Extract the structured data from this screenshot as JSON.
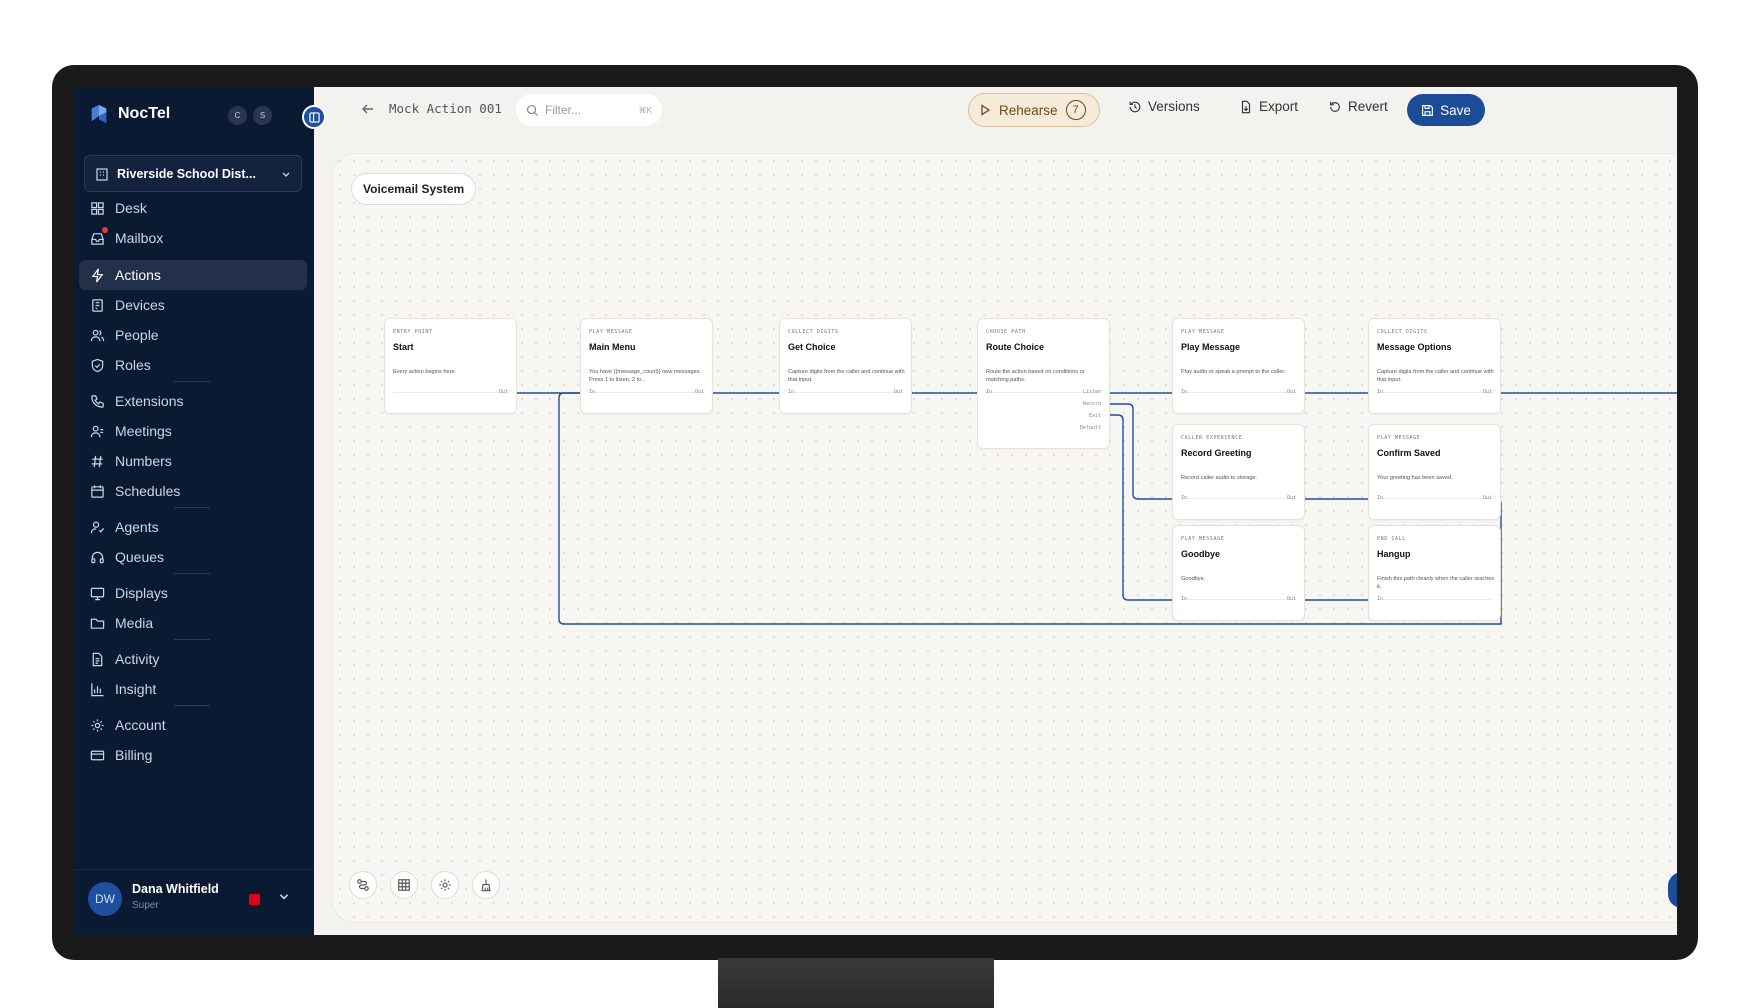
{
  "brand": {
    "name": "NocTel",
    "badges": [
      "C",
      "S"
    ]
  },
  "org": {
    "name": "Riverside School Dist..."
  },
  "nav": [
    {
      "label": "Desk",
      "icon": "grid-icon"
    },
    {
      "label": "Mailbox",
      "icon": "inbox-icon",
      "notification": true
    },
    {
      "label": "Actions",
      "icon": "lightning-icon",
      "active": true
    },
    {
      "label": "Devices",
      "icon": "device-icon"
    },
    {
      "label": "People",
      "icon": "people-icon"
    },
    {
      "label": "Roles",
      "icon": "shield-icon"
    },
    {
      "label": "Extensions",
      "icon": "phone-icon"
    },
    {
      "label": "Meetings",
      "icon": "meetings-icon"
    },
    {
      "label": "Numbers",
      "icon": "hash-icon"
    },
    {
      "label": "Schedules",
      "icon": "calendar-icon"
    },
    {
      "label": "Agents",
      "icon": "agent-icon"
    },
    {
      "label": "Queues",
      "icon": "headset-icon"
    },
    {
      "label": "Displays",
      "icon": "monitor-icon"
    },
    {
      "label": "Media",
      "icon": "folder-icon"
    },
    {
      "label": "Activity",
      "icon": "document-icon"
    },
    {
      "label": "Insight",
      "icon": "bar-chart-icon"
    },
    {
      "label": "Account",
      "icon": "gear-icon"
    },
    {
      "label": "Billing",
      "icon": "credit-card-icon"
    }
  ],
  "user": {
    "initials": "DW",
    "name": "Dana Whitfield",
    "role": "Super",
    "status_color": "#e0001b"
  },
  "topbar": {
    "title": "Mock Action 001",
    "filter_placeholder": "Filter...",
    "filter_shortcut": "⌘K",
    "rehearse_label": "Rehearse",
    "rehearse_count": "7",
    "versions_label": "Versions",
    "export_label": "Export",
    "revert_label": "Revert",
    "save_label": "Save"
  },
  "canvas": {
    "flow_name": "Voicemail System",
    "nodes": [
      {
        "kind": "ENTRY POINT",
        "title": "Start",
        "desc": "Every action begins here.",
        "ports": [
          "Out"
        ]
      },
      {
        "kind": "PLAY MESSAGE",
        "title": "Main Menu",
        "desc": "You have {{message_count}} new messages. Press 1 to listen, 2 to...",
        "ports": [
          "In",
          "Out"
        ]
      },
      {
        "kind": "COLLECT DIGITS",
        "title": "Get Choice",
        "desc": "Capture digits from the caller and continue with that input.",
        "ports": [
          "In",
          "Out"
        ]
      },
      {
        "kind": "CHOOSE PATH",
        "title": "Route Choice",
        "desc": "Route the action based on conditions or matching paths.",
        "ports": [
          "In",
          "Listen",
          "Record",
          "Exit",
          "Default"
        ]
      },
      {
        "kind": "PLAY MESSAGE",
        "title": "Play Message",
        "desc": "Play audio or speak a prompt to the caller.",
        "ports": [
          "In",
          "Out"
        ]
      },
      {
        "kind": "COLLECT DIGITS",
        "title": "Message Options",
        "desc": "Capture digits from the caller and continue with that input.",
        "ports": [
          "In",
          "Out"
        ]
      },
      {
        "kind": "CALLER EXPERIENCE",
        "title": "Record Greeting",
        "desc": "Record caller audio to storage.",
        "ports": [
          "In",
          "Out"
        ]
      },
      {
        "kind": "PLAY MESSAGE",
        "title": "Confirm Saved",
        "desc": "Your greeting has been saved.",
        "ports": [
          "In",
          "Out"
        ]
      },
      {
        "kind": "PLAY MESSAGE",
        "title": "Goodbye",
        "desc": "Goodbye.",
        "ports": [
          "In",
          "Out"
        ]
      },
      {
        "kind": "END CALL",
        "title": "Hangup",
        "desc": "Finish this path cleanly when the caller reaches it.",
        "ports": [
          "In"
        ]
      }
    ],
    "tools": [
      "flow-icon",
      "grid-icon",
      "gear-icon",
      "broom-icon"
    ]
  },
  "colors": {
    "sidebar": "#0b1a33",
    "accent": "#1c4c98",
    "wire": "#1f4f9e",
    "rehearse_bg": "#f6ead8"
  }
}
